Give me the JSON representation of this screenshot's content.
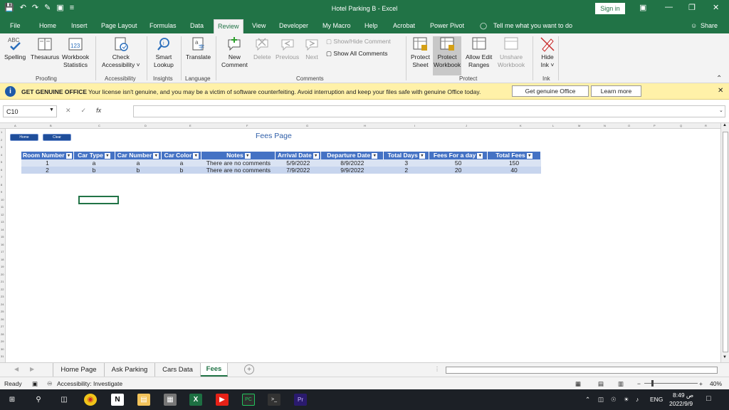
{
  "window": {
    "title": "Hotel Parking B  -  Excel",
    "signin": "Sign in",
    "controls": [
      "▣",
      "—",
      "❐",
      "✕"
    ]
  },
  "menu": {
    "tabs": [
      "File",
      "Home",
      "Insert",
      "Page Layout",
      "Formulas",
      "Data",
      "Review",
      "View",
      "Developer",
      "My Macro",
      "Help",
      "Acrobat",
      "Power Pivot"
    ],
    "active": "Review",
    "tellme": "Tell me what you want to do",
    "share": "Share"
  },
  "ribbon": {
    "spelling": "Spelling",
    "thesaurus": "Thesaurus",
    "workbook_statistics_1": "Workbook",
    "workbook_statistics_2": "Statistics",
    "check_accessibility_1": "Check",
    "check_accessibility_2": "Accessibility ˅",
    "smart_lookup_1": "Smart",
    "smart_lookup_2": "Lookup",
    "translate": "Translate",
    "new_comment_1": "New",
    "new_comment_2": "Comment",
    "delete": "Delete",
    "previous": "Previous",
    "next": "Next",
    "show_hide_comment": "Show/Hide Comment",
    "show_all_comments": "Show All Comments",
    "protect_sheet_1": "Protect",
    "protect_sheet_2": "Sheet",
    "protect_workbook_1": "Protect",
    "protect_workbook_2": "Workbook",
    "allow_edit_1": "Allow Edit",
    "allow_edit_2": "Ranges",
    "unshare_1": "Unshare",
    "unshare_2": "Workbook",
    "hide_ink_1": "Hide",
    "hide_ink_2": "Ink ˅",
    "groups": [
      "Proofing",
      "Accessibility",
      "Insights",
      "Language",
      "Comments",
      "Protect",
      "Ink"
    ]
  },
  "warning": {
    "title": "GET GENUINE OFFICE",
    "message": "Your license isn't genuine, and you may be a victim of software counterfeiting. Avoid interruption and keep your files safe with genuine Office today.",
    "get_button": "Get genuine Office",
    "learn_button": "Learn more"
  },
  "formula": {
    "namebox": "C10",
    "fx": "fx",
    "value": ""
  },
  "grid": {
    "columns": [
      "A",
      "B",
      "C",
      "D",
      "E",
      "F",
      "G",
      "H",
      "I",
      "J",
      "K",
      "L",
      "M",
      "N",
      "O",
      "P",
      "Q",
      "R"
    ],
    "rows": [
      "1",
      "2",
      "3",
      "4",
      "5",
      "6",
      "7",
      "8",
      "9",
      "10",
      "11",
      "12",
      "13",
      "14",
      "15",
      "16",
      "17",
      "18",
      "19",
      "20",
      "21",
      "22",
      "23",
      "24",
      "25",
      "26",
      "27",
      "28",
      "29",
      "30",
      "31"
    ]
  },
  "sheet": {
    "home_button": "Home",
    "clear_button": "Clear",
    "title": "Fees Page",
    "headers": [
      "Room Number",
      "Car Type",
      "Car Number",
      "Car Color",
      "Notes",
      "Arrival Date",
      "Departure Date",
      "Total Days",
      "Fees For a day",
      "Total Fees"
    ],
    "rows": [
      [
        "1",
        "a",
        "a",
        "a",
        "There are no comments",
        "5/9/2022",
        "8/9/2022",
        "3",
        "50",
        "150"
      ],
      [
        "2",
        "b",
        "b",
        "b",
        "There are no comments",
        "7/9/2022",
        "9/9/2022",
        "2",
        "20",
        "40"
      ]
    ]
  },
  "tabs": {
    "sheets": [
      "Home Page",
      "Ask Parking",
      "Cars Data",
      "Fees"
    ],
    "active": "Fees",
    "add": "+"
  },
  "status": {
    "ready": "Ready",
    "accessibility": "Accessibility: Investigate",
    "zoom": "40%"
  },
  "taskbar": {
    "lang": "ENG",
    "time": "8:49 ص",
    "date": "2022/9/9"
  },
  "colors": {
    "excel_green": "#217346",
    "table_header": "#4472c4",
    "warning_bg": "#fff1a8"
  }
}
